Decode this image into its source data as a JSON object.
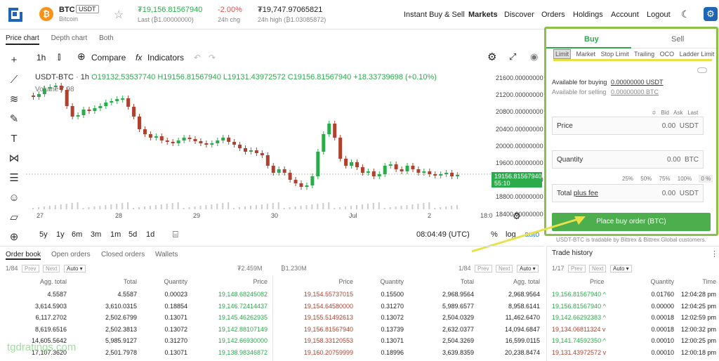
{
  "header": {
    "pair_symbol": "BTC",
    "pair_quote": "USDT",
    "pair_name": "Bitcoin",
    "last_price": "₮19,156.81567940",
    "last_label": "Last (₿1.00000000)",
    "change": "-2.00%",
    "change_label": "24h chg",
    "high": "₮19,747.97065821",
    "high_label": "24h high (₿1.03085872)",
    "nav": [
      "Instant Buy & Sell",
      "Markets",
      "Discover",
      "Orders",
      "Holdings",
      "Account",
      "Logout"
    ]
  },
  "chart": {
    "tabs": [
      "Price chart",
      "Depth chart",
      "Both"
    ],
    "interval": "1h",
    "compare_label": "Compare",
    "indicators_label": "Indicators",
    "symbol": "USDT-BTC",
    "ohlc_interval": "1h",
    "o": "O19132.53537740",
    "h": "H19156.81567940",
    "l": "L19131.43972572",
    "c": "C19156.81567940",
    "delta": "+18.33739698 (+0.10%)",
    "volume_label": "Volume",
    "volume_value": "7.98",
    "y_ticks": [
      "21600.00000000",
      "21200.00000000",
      "20800.00000000",
      "20400.00000000",
      "20000.00000000",
      "19600.00000000",
      "19200.00000000",
      "18800.00000000",
      "18400.00000000"
    ],
    "current_price": "19156.81567940",
    "countdown": "55:10",
    "x_ticks": [
      "27",
      "28",
      "29",
      "30",
      "Jul",
      "2",
      "18:0"
    ],
    "ranges": [
      "5y",
      "1y",
      "6m",
      "3m",
      "1m",
      "5d",
      "1d"
    ],
    "time": "08:04:49 (UTC)",
    "pct_label": "%",
    "log_label": "log",
    "auto_label": "auto",
    "colors": {
      "up": "#2bab4b",
      "down": "#b0412e"
    }
  },
  "order_form": {
    "tabs": [
      "Buy",
      "Sell"
    ],
    "types": [
      "Limit",
      "Market",
      "Stop Limit",
      "Trailing",
      "OCO",
      "Ladder Limit"
    ],
    "available_buying_label": "Available for buying",
    "available_buying_value": "0.00000000 USDT",
    "available_selling_label": "Available for selling",
    "available_selling_value": "0.00000000 BTC",
    "quick": [
      "Bid",
      "Ask",
      "Last"
    ],
    "price_label": "Price",
    "price_value": "0.00",
    "price_unit": "USDT",
    "qty_label": "Quantity",
    "qty_value": "0.00",
    "qty_unit": "BTC",
    "pcts": [
      "25%",
      "50%",
      "75%",
      "100%",
      "0 %"
    ],
    "total_label": "Total",
    "total_plus": "plus fee",
    "total_value": "0.00",
    "total_unit": "USDT",
    "place_label": "Place buy order (BTC)",
    "note": "USDT-BTC is tradable by Bittrex & Bittrex Global customers."
  },
  "bottom_tabs": [
    "Order book",
    "Open orders",
    "Closed orders",
    "Wallets"
  ],
  "orderbook": {
    "left_pages": "1/84",
    "right_pages": "1/84",
    "prev": "Prev",
    "next": "Next",
    "auto": "Auto",
    "left_sum": "₮2.459M",
    "right_sum": "₿1.230M",
    "bid_headers": [
      "Agg. total",
      "Total",
      "Quantity",
      "Price"
    ],
    "ask_headers": [
      "Price",
      "Quantity",
      "Total",
      "Agg. total"
    ],
    "bids": [
      [
        "4.5587",
        "4.5587",
        "0.00023",
        "19,148.68245082"
      ],
      [
        "3,614.5903",
        "3,610.0315",
        "0.18854",
        "19,146.72414437"
      ],
      [
        "6,117.2702",
        "2,502.6799",
        "0.13071",
        "19,145.46262935"
      ],
      [
        "8,619.6516",
        "2,502.3813",
        "0.13072",
        "19,142.88107149"
      ],
      [
        "14,605.5642",
        "5,985.9127",
        "0.31270",
        "19,142.66930000"
      ],
      [
        "17,107.3620",
        "2,501.7978",
        "0.13071",
        "19,138.98346872"
      ]
    ],
    "asks": [
      [
        "19,154.55737015",
        "0.15500",
        "2,968.9564",
        "2,968.9564"
      ],
      [
        "19,154.64580000",
        "0.31270",
        "5,989.6577",
        "8,958.6141"
      ],
      [
        "19,155.51492613",
        "0.13072",
        "2,504.0329",
        "11,462.6470"
      ],
      [
        "19,156.81567940",
        "0.13739",
        "2,632.0377",
        "14,094.6847"
      ],
      [
        "19,158.33120553",
        "0.13071",
        "2,504.3269",
        "16,599.0115"
      ],
      [
        "19,160.20759999",
        "0.18996",
        "3,639.8359",
        "20,238.8474"
      ]
    ]
  },
  "trade_history": {
    "title": "Trade history",
    "pages": "1/17",
    "headers": [
      "Price",
      "Quantity",
      "Time"
    ],
    "rows": [
      [
        "19,156.81567940 ^",
        "0.01760",
        "12:04:28 pm",
        "up"
      ],
      [
        "19,156.81567940 ^",
        "0.00000",
        "12:04:25 pm",
        "up"
      ],
      [
        "19,142.66292383 ^",
        "0.00018",
        "12:02:59 pm",
        "up"
      ],
      [
        "19,134.06811324 v",
        "0.00018",
        "12:00:32 pm",
        "down"
      ],
      [
        "19,141.74592350 ^",
        "0.00010",
        "12:00:25 pm",
        "up"
      ],
      [
        "19,131.43972572 v",
        "0.00010",
        "12:00:18 pm",
        "down"
      ]
    ]
  },
  "watermark": "tgdratings.com"
}
